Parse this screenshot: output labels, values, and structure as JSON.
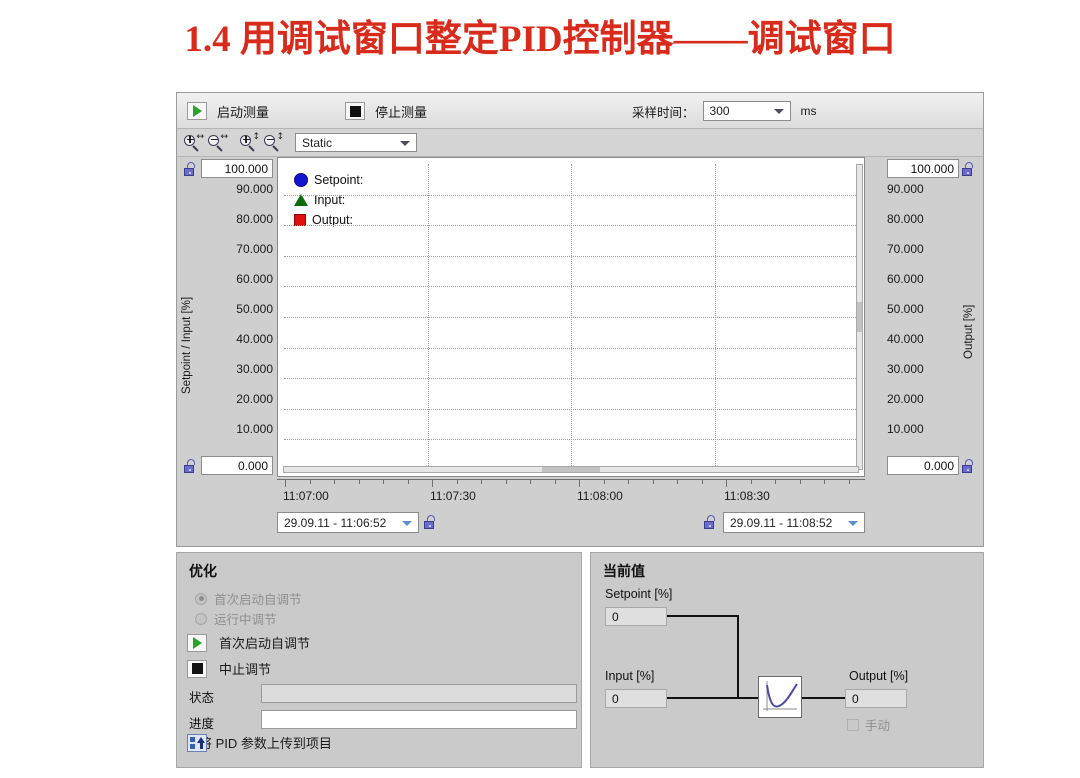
{
  "slide": {
    "title": "1.4 用调试窗口整定PID控制器——调试窗口",
    "title_color": "#d92b1c"
  },
  "toolbar": {
    "start_measure_label": "启动测量",
    "stop_measure_label": "停止测量",
    "sampling_time_label": "采样时间：",
    "sampling_time_value": "300",
    "sampling_time_unit": "ms",
    "view_mode_value": "Static",
    "zoom_icons": [
      "zoom-in-horizontal",
      "zoom-out-horizontal",
      "zoom-in-vertical",
      "zoom-out-vertical"
    ]
  },
  "chart": {
    "left_axis_label": "Setpoint / Input  [%]",
    "right_axis_label": "Output  [%]",
    "left_top_value": "100.000",
    "left_bottom_value": "0.000",
    "right_top_value": "100.000",
    "right_bottom_value": "0.000",
    "start_time": "29.09.11 - 11:06:52",
    "end_time": "29.09.11 - 11:08:52",
    "legend": [
      {
        "label": "Setpoint:",
        "marker": "circle",
        "color": "#1414d0"
      },
      {
        "label": "Input:",
        "marker": "triangle",
        "color": "#0b6b0b"
      },
      {
        "label": "Output:",
        "marker": "square",
        "color": "#e01010"
      }
    ]
  },
  "chart_data": {
    "type": "line",
    "title": "",
    "xlabel": "",
    "ylabel": "Setpoint / Input  [%]",
    "y2label": "Output  [%]",
    "grid": true,
    "legend_position": "top-left",
    "ylim": [
      0,
      100
    ],
    "y2lim": [
      0,
      100
    ],
    "yticks": [
      "0.000",
      "10.000",
      "20.000",
      "30.000",
      "40.000",
      "50.000",
      "60.000",
      "70.000",
      "80.000",
      "90.000",
      "100.000"
    ],
    "y2ticks": [
      "0.000",
      "10.000",
      "20.000",
      "30.000",
      "40.000",
      "50.000",
      "60.000",
      "70.000",
      "80.000",
      "90.000",
      "100.000"
    ],
    "xticks": [
      "11:07:00",
      "11:07:30",
      "11:08:00",
      "11:08:30"
    ],
    "xrange": [
      "29.09.11 - 11:06:52",
      "29.09.11 - 11:08:52"
    ],
    "series": [
      {
        "name": "Setpoint:",
        "color": "#1414d0",
        "values": []
      },
      {
        "name": "Input:",
        "color": "#0b6b0b",
        "values": []
      },
      {
        "name": "Output:",
        "color": "#e01010",
        "values": []
      }
    ]
  },
  "optimization": {
    "title": "优化",
    "radio_first_start": "首次启动自调节",
    "radio_in_run": "运行中调节",
    "btn_first_start": "首次启动自调节",
    "btn_abort": "中止调节",
    "status_label": "状态",
    "status_value": "",
    "progress_label": "进度",
    "progress_value": "",
    "upload_label": "将 PID 参数上传到项目"
  },
  "current_values": {
    "title": "当前值",
    "setpoint_label": "Setpoint [%]",
    "setpoint_value": "0",
    "input_label": "Input [%]",
    "input_value": "0",
    "output_label": "Output [%]",
    "output_value": "0",
    "manual_label": "手动"
  }
}
